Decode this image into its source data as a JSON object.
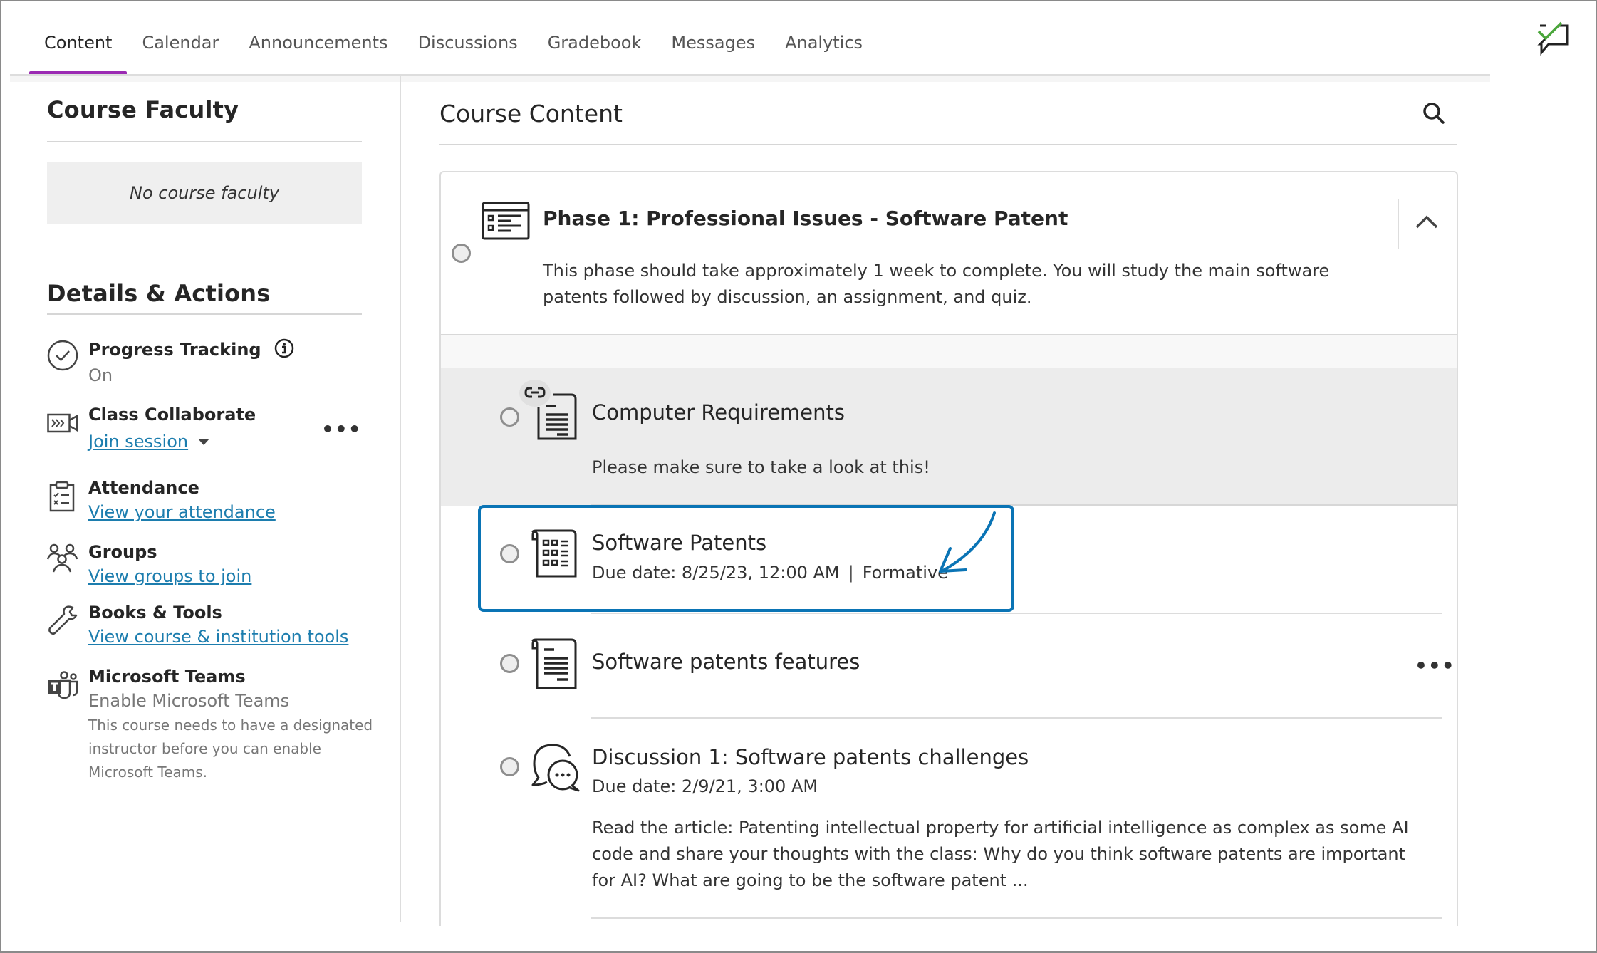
{
  "nav": {
    "tabs": [
      {
        "label": "Content",
        "active": true
      },
      {
        "label": "Calendar",
        "active": false
      },
      {
        "label": "Announcements",
        "active": false
      },
      {
        "label": "Discussions",
        "active": false
      },
      {
        "label": "Gradebook",
        "active": false
      },
      {
        "label": "Messages",
        "active": false
      },
      {
        "label": "Analytics",
        "active": false
      }
    ],
    "accent_color": "#9b2ab3",
    "feedback_icon": "feedback-check-icon"
  },
  "sidebar": {
    "faculty_title": "Course Faculty",
    "faculty_empty": "No course faculty",
    "details_title": "Details & Actions",
    "progress": {
      "title": "Progress Tracking",
      "status": "On",
      "icon": "check-circle-icon"
    },
    "collaborate": {
      "title": "Class Collaborate",
      "link": "Join session",
      "icon": "video-camera-icon"
    },
    "attendance": {
      "title": "Attendance",
      "link": "View your attendance",
      "icon": "clipboard-icon"
    },
    "groups": {
      "title": "Groups",
      "link": "View groups to join",
      "icon": "groups-icon"
    },
    "books": {
      "title": "Books & Tools",
      "link": "View course & institution tools",
      "icon": "wrench-icon"
    },
    "teams": {
      "title": "Microsoft Teams",
      "sub": "Enable Microsoft Teams",
      "note": "This course needs to have a designated instructor before you can enable Microsoft Teams.",
      "icon": "teams-icon"
    },
    "link_color": "#1c7dae"
  },
  "content": {
    "title": "Course Content",
    "search_icon": "search-icon",
    "phase": {
      "title": "Phase 1: Professional Issues - Software Patent",
      "description": "This phase should take approximately 1 week to complete. You will study the main software patents followed by discussion, an assignment, and quiz."
    },
    "items": [
      {
        "title": "Computer Requirements",
        "description": "Please make sure to take a look at this!",
        "icon": "document-link-icon"
      },
      {
        "title": "Software Patents",
        "meta": "Due date: 8/25/23, 12:00 AM",
        "tag": "Formative",
        "icon": "assessment-icon",
        "highlighted": true
      },
      {
        "title": "Software patents features",
        "icon": "document-icon"
      },
      {
        "title": "Discussion 1: Software patents challenges",
        "meta": "Due date: 2/9/21, 3:00 AM",
        "description": "Read the article: Patenting intellectual property for artificial intelligence as complex as some AI code and share your thoughts with the class: Why do you think software patents are important for AI? What are going to be the software patent ...",
        "icon": "discussion-icon"
      }
    ],
    "highlight_color": "#0a74b5"
  }
}
